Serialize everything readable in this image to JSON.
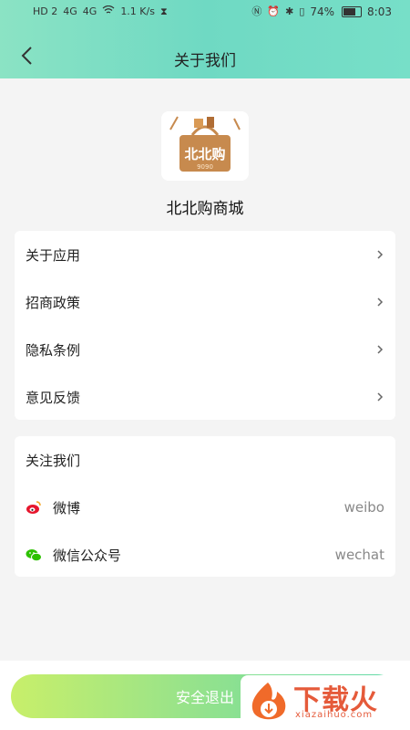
{
  "status_bar": {
    "left_icons": [
      "HD 2",
      "4G",
      "4G",
      "1.1 K/s"
    ],
    "battery": "74%",
    "time": "8:03"
  },
  "nav": {
    "title": "关于我们"
  },
  "app": {
    "name": "北北购商城",
    "logo_text": "北北购",
    "logo_sub": "9090"
  },
  "menu": {
    "items": [
      {
        "label": "关于应用"
      },
      {
        "label": "招商政策"
      },
      {
        "label": "隐私条例"
      },
      {
        "label": "意见反馈"
      }
    ]
  },
  "follow": {
    "title": "关注我们",
    "items": [
      {
        "icon": "weibo-icon",
        "label": "微博",
        "value": "weibo"
      },
      {
        "icon": "wechat-icon",
        "label": "微信公众号",
        "value": "wechat"
      }
    ]
  },
  "logout": {
    "label": "安全退出"
  },
  "watermark": {
    "text": "下载火",
    "sub": "xiazaihuo.com"
  },
  "colors": {
    "header": "#7fdec6",
    "accent_start": "#c8ef6a",
    "accent_end": "#5fd9a9",
    "watermark": "#e55a3a"
  }
}
